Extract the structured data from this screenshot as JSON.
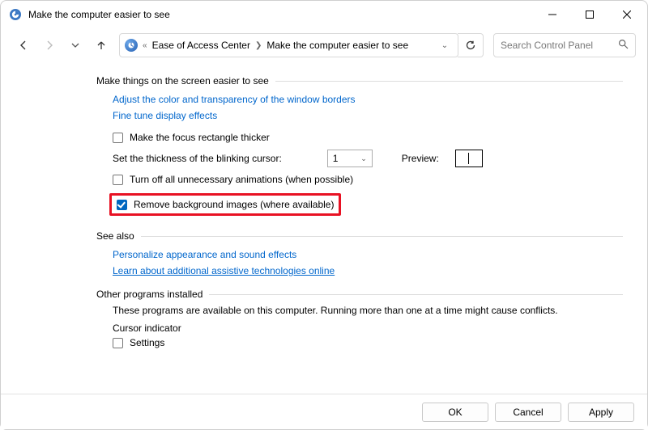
{
  "window": {
    "title": "Make the computer easier to see"
  },
  "breadcrumb": {
    "root_chevrons": "«",
    "item1": "Ease of Access Center",
    "item2": "Make the computer easier to see"
  },
  "search": {
    "placeholder": "Search Control Panel"
  },
  "sections": {
    "make_easier": {
      "header": "Make things on the screen easier to see",
      "link_colors": "Adjust the color and transparency of the window borders",
      "link_display": "Fine tune display effects",
      "cb_focus": "Make the focus rectangle thicker",
      "thickness_label": "Set the thickness of the blinking cursor:",
      "thickness_value": "1",
      "preview_label": "Preview:",
      "cb_animations": "Turn off all unnecessary animations (when possible)",
      "cb_bg_images": "Remove background images (where available)"
    },
    "see_also": {
      "header": "See also",
      "link_personalize": "Personalize appearance and sound effects",
      "link_learn": "Learn about additional assistive technologies online"
    },
    "other": {
      "header": "Other programs installed",
      "desc": "These programs are available on this computer. Running more than one at a time might cause conflicts.",
      "cursor_indicator": "Cursor indicator",
      "cb_settings": "Settings"
    }
  },
  "footer": {
    "ok": "OK",
    "cancel": "Cancel",
    "apply": "Apply"
  }
}
